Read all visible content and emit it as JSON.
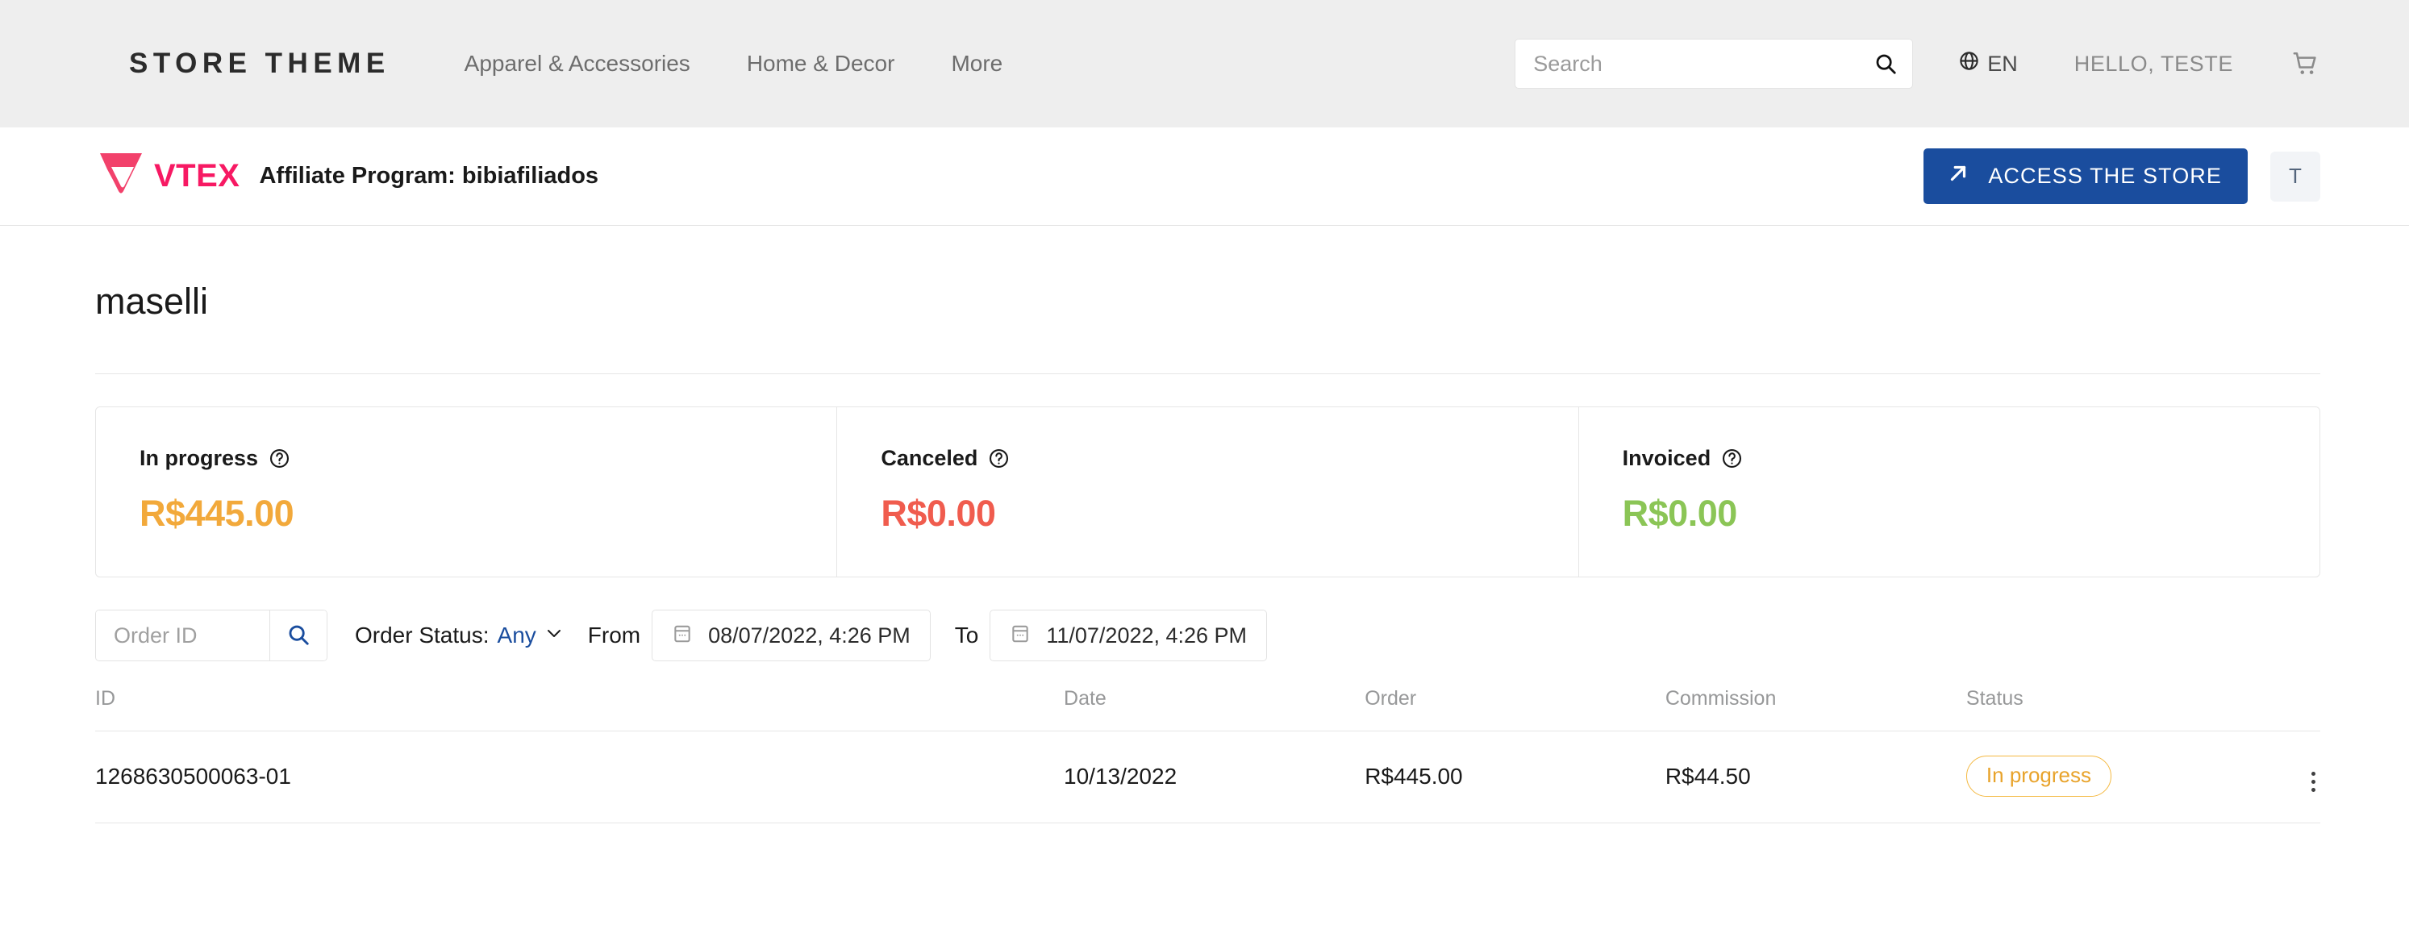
{
  "storefront": {
    "logo": "STORE THEME",
    "nav": [
      {
        "label": "Apparel & Accessories"
      },
      {
        "label": "Home & Decor"
      },
      {
        "label": "More"
      }
    ],
    "search": {
      "placeholder": "Search",
      "value": "",
      "icon": "search-icon"
    },
    "language": {
      "label": "EN",
      "icon": "globe-icon"
    },
    "account": "HELLO, TESTE",
    "cart": {
      "icon": "cart-icon"
    }
  },
  "admin_bar": {
    "brand": "VTEX",
    "title": "Affiliate Program: bibiafiliados",
    "access_store_label": "ACCESS THE STORE",
    "access_store_icon": "arrow-up-right-icon",
    "avatar_initial": "T"
  },
  "page": {
    "title": "maselli"
  },
  "cards": [
    {
      "label": "In progress",
      "value": "R$445.00",
      "color": "#f2a93b",
      "help_icon": "help-circle-icon"
    },
    {
      "label": "Canceled",
      "value": "R$0.00",
      "color": "#f05c4e",
      "help_icon": "help-circle-icon"
    },
    {
      "label": "Invoiced",
      "value": "R$0.00",
      "color": "#8bc556",
      "help_icon": "help-circle-icon"
    }
  ],
  "filters": {
    "order_id": {
      "placeholder": "Order ID",
      "value": ""
    },
    "order_id_search_icon": "search-icon",
    "status": {
      "label": "Order Status:",
      "value": "Any",
      "chevron": "chevron-down-icon"
    },
    "from": {
      "label": "From",
      "value": "08/07/2022, 4:26 PM",
      "icon": "calendar-icon"
    },
    "to": {
      "label": "To",
      "value": "11/07/2022, 4:26 PM",
      "icon": "calendar-icon"
    }
  },
  "table": {
    "columns": [
      "ID",
      "Date",
      "Order",
      "Commission",
      "Status"
    ],
    "rows": [
      {
        "id": "1268630500063-01",
        "date": "10/13/2022",
        "order": "R$445.00",
        "commission": "R$44.50",
        "status": "In progress",
        "status_color": "#e8a32b",
        "actions_icon": "kebab-menu-icon"
      }
    ]
  },
  "colors": {
    "brand_pink": "#f71963",
    "primary_blue": "#1a4d9e",
    "header_bg": "#eeeeee"
  }
}
